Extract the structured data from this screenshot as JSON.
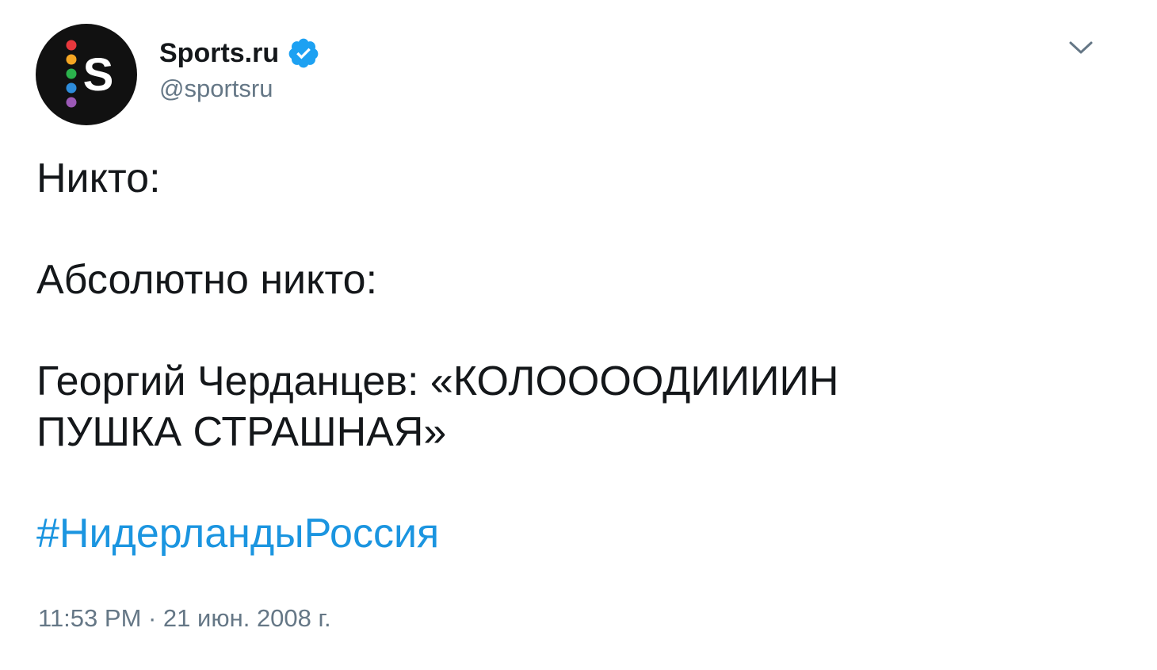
{
  "author": {
    "display_name": "Sports.ru",
    "handle": "@sportsru",
    "verified": true,
    "avatar_letter": "S",
    "avatar_dot_colors": [
      "#e8383d",
      "#f5a623",
      "#2bb24c",
      "#2d8cdb",
      "#9b59b6"
    ]
  },
  "icons": {
    "verified": "verified-badge-icon",
    "menu": "chevron-down-icon"
  },
  "tweet": {
    "line1": "Никто:",
    "line2": "Абсолютно никто:",
    "line3a": "Георгий Черданцев: «КОЛООООДИИИИН",
    "line3b": "ПУШКА СТРАШНАЯ»",
    "hashtag": "#НидерландыРоссия",
    "timestamp": "11:53 PM · 21 июн. 2008 г."
  },
  "colors": {
    "link": "#1b95e0",
    "verified": "#1da1f2",
    "secondary_text": "#657786",
    "primary_text": "#14171a"
  }
}
